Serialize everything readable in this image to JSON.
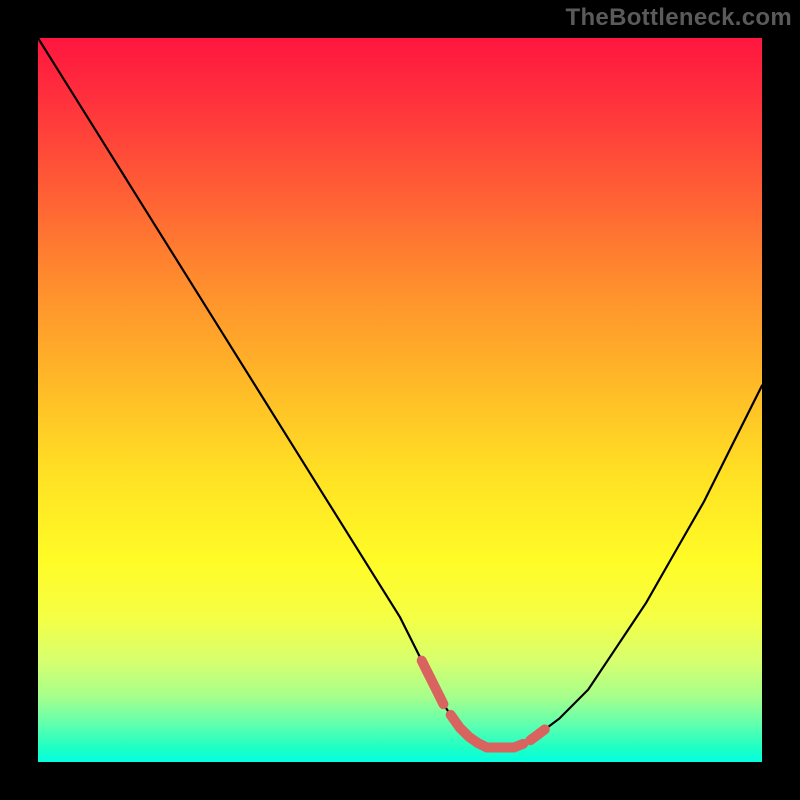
{
  "watermark": "TheBottleneck.com",
  "chart_data": {
    "type": "line",
    "title": "",
    "xlabel": "",
    "ylabel": "",
    "xlim": [
      0,
      100
    ],
    "ylim": [
      0,
      100
    ],
    "grid": false,
    "series": [
      {
        "name": "bottleneck-curve",
        "x": [
          0,
          5,
          10,
          15,
          20,
          25,
          30,
          35,
          40,
          45,
          50,
          54,
          56,
          58,
          60,
          62,
          64,
          66,
          68,
          72,
          76,
          80,
          84,
          88,
          92,
          96,
          100
        ],
        "values": [
          100,
          92,
          84,
          76,
          68,
          60,
          52,
          44,
          36,
          28,
          20,
          12,
          8,
          5,
          3,
          2,
          2,
          2,
          3,
          6,
          10,
          16,
          22,
          29,
          36,
          44,
          52
        ]
      }
    ],
    "annotations": [
      {
        "name": "valley-highlight",
        "x_range": [
          53,
          70
        ],
        "color": "#d9635f"
      }
    ],
    "background": {
      "type": "vertical-gradient",
      "stops": [
        {
          "pos": 0,
          "color": "#ff163f"
        },
        {
          "pos": 20,
          "color": "#ff5a36"
        },
        {
          "pos": 46,
          "color": "#ffb428"
        },
        {
          "pos": 72,
          "color": "#fffb26"
        },
        {
          "pos": 91,
          "color": "#a6ff8c"
        },
        {
          "pos": 100,
          "color": "#04ffe0"
        }
      ]
    }
  }
}
